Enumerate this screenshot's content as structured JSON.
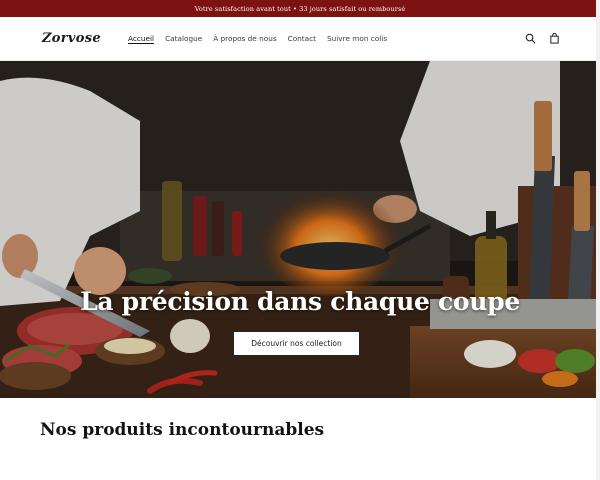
{
  "announcement": {
    "text": "Votre satisfaction avant tout • 33 jours satisfait ou remboursé"
  },
  "header": {
    "logo": "Zorvose",
    "nav": [
      {
        "label": "Accueil",
        "active": true
      },
      {
        "label": "Catalogue"
      },
      {
        "label": "À propos de nous"
      },
      {
        "label": "Contact"
      },
      {
        "label": "Suivre mon colis"
      }
    ],
    "icons": [
      "search-icon",
      "cart-icon"
    ]
  },
  "hero": {
    "title": "La précision dans chaque coupe",
    "cta_label": "Découvrir nos collection"
  },
  "section": {
    "title": "Nos produits incontournables"
  },
  "colors": {
    "announcement_bg": "#7d1212",
    "hero_text": "#ffffff",
    "button_bg": "#ffffff"
  }
}
